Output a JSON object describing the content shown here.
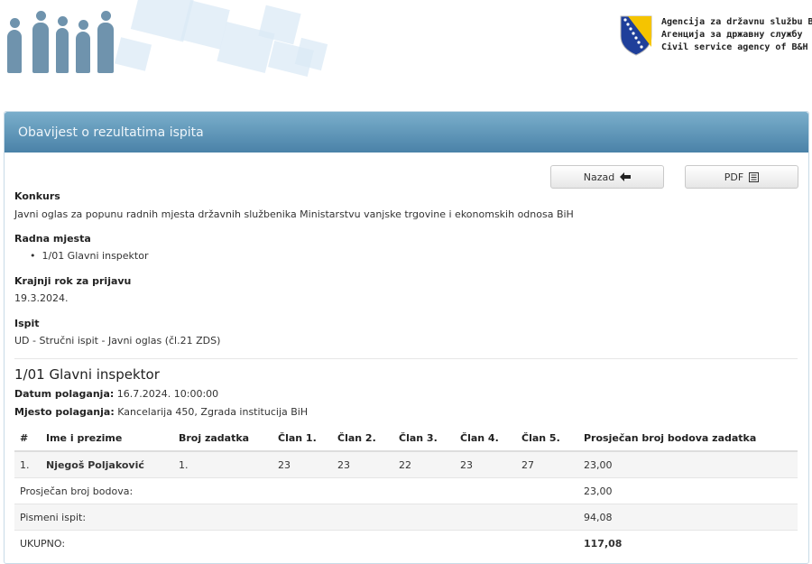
{
  "header": {
    "agency_bs": "Agencija za državnu službu BiH",
    "agency_sr": "Агенција за државну службу",
    "agency_en": "Civil service agency of B&H"
  },
  "panel": {
    "title": "Obavijest o rezultatima ispita",
    "back_label": "Nazad",
    "pdf_label": "PDF"
  },
  "details": {
    "konkurs_label": "Konkurs",
    "konkurs_value": "Javni oglas za popunu radnih mjesta državnih službenika Ministarstvu vanjske trgovine i ekonomskih odnosa BiH",
    "radna_label": "Radna mjesta",
    "radna_items": [
      "1/01 Glavni inspektor"
    ],
    "rok_label": "Krajnji rok za prijavu",
    "rok_value": "19.3.2024.",
    "ispit_label": "Ispit",
    "ispit_value": "UD - Stručni ispit - Javni oglas (čl.21 ZDS)"
  },
  "position": {
    "title": "1/01 Glavni inspektor",
    "datum_label": "Datum polaganja:",
    "datum_value": "16.7.2024. 10:00:00",
    "mjesto_label": "Mjesto polaganja:",
    "mjesto_value": "Kancelarija 450, Zgrada institucija BiH"
  },
  "table": {
    "headers": [
      "#",
      "Ime i prezime",
      "Broj zadatka",
      "Član 1.",
      "Član 2.",
      "Član 3.",
      "Član 4.",
      "Član 5.",
      "Prosječan broj bodova zadatka"
    ],
    "rows": [
      [
        "1.",
        "Njegoš Poljaković",
        "1.",
        "23",
        "23",
        "22",
        "23",
        "27",
        "23,00"
      ]
    ],
    "summary": [
      {
        "label": "Prosječan broj bodova:",
        "value": "23,00"
      },
      {
        "label": "Pismeni ispit:",
        "value": "94,08"
      },
      {
        "label": "UKUPNO:",
        "value": "117,08"
      }
    ]
  }
}
